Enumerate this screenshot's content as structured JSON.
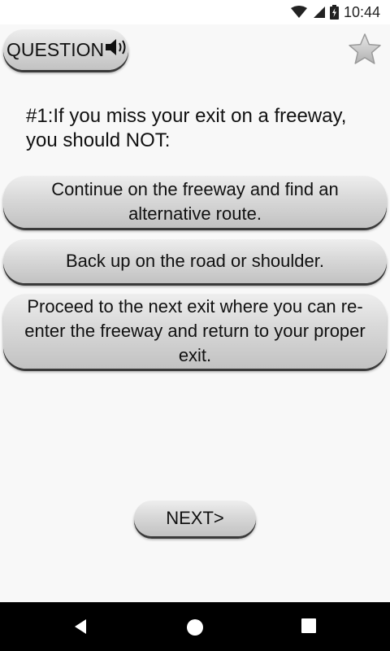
{
  "status_bar": {
    "time": "10:44",
    "icons": [
      "wifi-icon",
      "signal-icon",
      "battery-icon"
    ]
  },
  "header": {
    "question_label": "QUESTION",
    "speaker_icon": "speaker-icon",
    "favorite_icon": "star-icon"
  },
  "question": {
    "text": "#1:If you miss your exit on a freeway, you should NOT:"
  },
  "answers": [
    {
      "label": "Continue on the freeway and find an alternative route."
    },
    {
      "label": "Back up on the road or shoulder."
    },
    {
      "label": "Proceed to the next exit where you can re-enter the freeway and return to your proper exit."
    }
  ],
  "footer": {
    "next_label": "NEXT>"
  },
  "nav_bar": {
    "buttons": [
      "back-icon",
      "home-icon",
      "recents-icon"
    ]
  },
  "colors": {
    "button_light": "#eeeeee",
    "button_dark": "#c2c2c2",
    "button_shadow": "#3a3a3a",
    "background": "#f8f8f8",
    "nav_bar": "#000000"
  }
}
